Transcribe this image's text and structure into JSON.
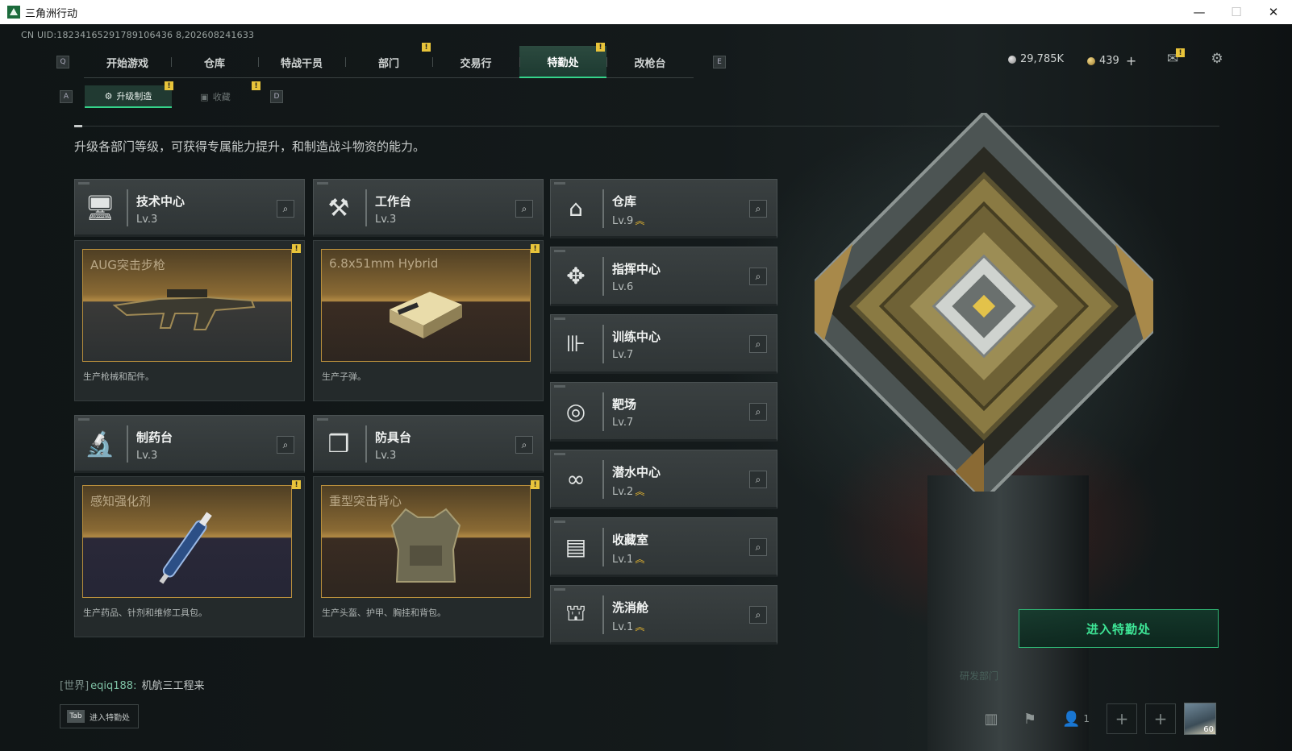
{
  "window": {
    "title": "三角洲行动",
    "minimize": "—",
    "maximize": "☐",
    "close": "✕"
  },
  "uid": "CN UID:18234165291789106436 8,202608241633",
  "nav": {
    "key_left": "Q",
    "key_right": "E",
    "tabs": [
      {
        "label": "开始游戏"
      },
      {
        "label": "仓库"
      },
      {
        "label": "特战干员"
      },
      {
        "label": "部门"
      },
      {
        "label": "交易行"
      },
      {
        "label": "特勤处"
      },
      {
        "label": "改枪台"
      }
    ],
    "badge_mark": "!"
  },
  "currency": {
    "silver": "29,785K",
    "gold": "439",
    "add": "+"
  },
  "subnav": {
    "key_left": "A",
    "key_right": "D",
    "active": "升级制造",
    "inactive": "收藏"
  },
  "intro": "升级各部门等级，可获得专属能力提升，和制造战斗物资的能力。",
  "cards": [
    {
      "name": "技术中心",
      "level": "Lv.3",
      "icon": "computer-icon",
      "preview_title": "AUG突击步枪",
      "desc": "生产枪械和配件。"
    },
    {
      "name": "工作台",
      "level": "Lv.3",
      "icon": "tools-icon",
      "preview_title": "6.8x51mm Hybrid",
      "desc": "生产子弹。"
    },
    {
      "name": "制药台",
      "level": "Lv.3",
      "icon": "microscope-icon",
      "preview_title": "感知强化剂",
      "desc": "生产药品、针剂和维修工具包。"
    },
    {
      "name": "防具台",
      "level": "Lv.3",
      "icon": "cubes-icon",
      "preview_title": "重型突击背心",
      "desc": "生产头盔、护甲、胸挂和背包。"
    }
  ],
  "facilities": [
    {
      "name": "仓库",
      "level": "Lv.9",
      "upgradeable": "︽",
      "icon": "warehouse-icon"
    },
    {
      "name": "指挥中心",
      "level": "Lv.6",
      "upgradeable": "",
      "icon": "command-chip-icon"
    },
    {
      "name": "训练中心",
      "level": "Lv.7",
      "upgradeable": "",
      "icon": "dumbbell-icon"
    },
    {
      "name": "靶场",
      "level": "Lv.7",
      "upgradeable": "",
      "icon": "target-icon"
    },
    {
      "name": "潜水中心",
      "level": "Lv.2",
      "upgradeable": "︽",
      "icon": "diving-mask-icon"
    },
    {
      "name": "收藏室",
      "level": "Lv.1",
      "upgradeable": "︽",
      "icon": "collection-icon"
    },
    {
      "name": "洗消舱",
      "level": "Lv.1",
      "upgradeable": "︽",
      "icon": "decon-chamber-icon"
    }
  ],
  "enter_button": "进入特勤处",
  "chat": {
    "channel": "[世界]",
    "user": "eqiq188:",
    "message": "机航三工程来"
  },
  "tab_hint": {
    "key": "Tab",
    "label": "进入特勤处"
  },
  "bottom": {
    "friends_count": "1",
    "avatar_level": "60"
  },
  "tower_label": "研发部门"
}
